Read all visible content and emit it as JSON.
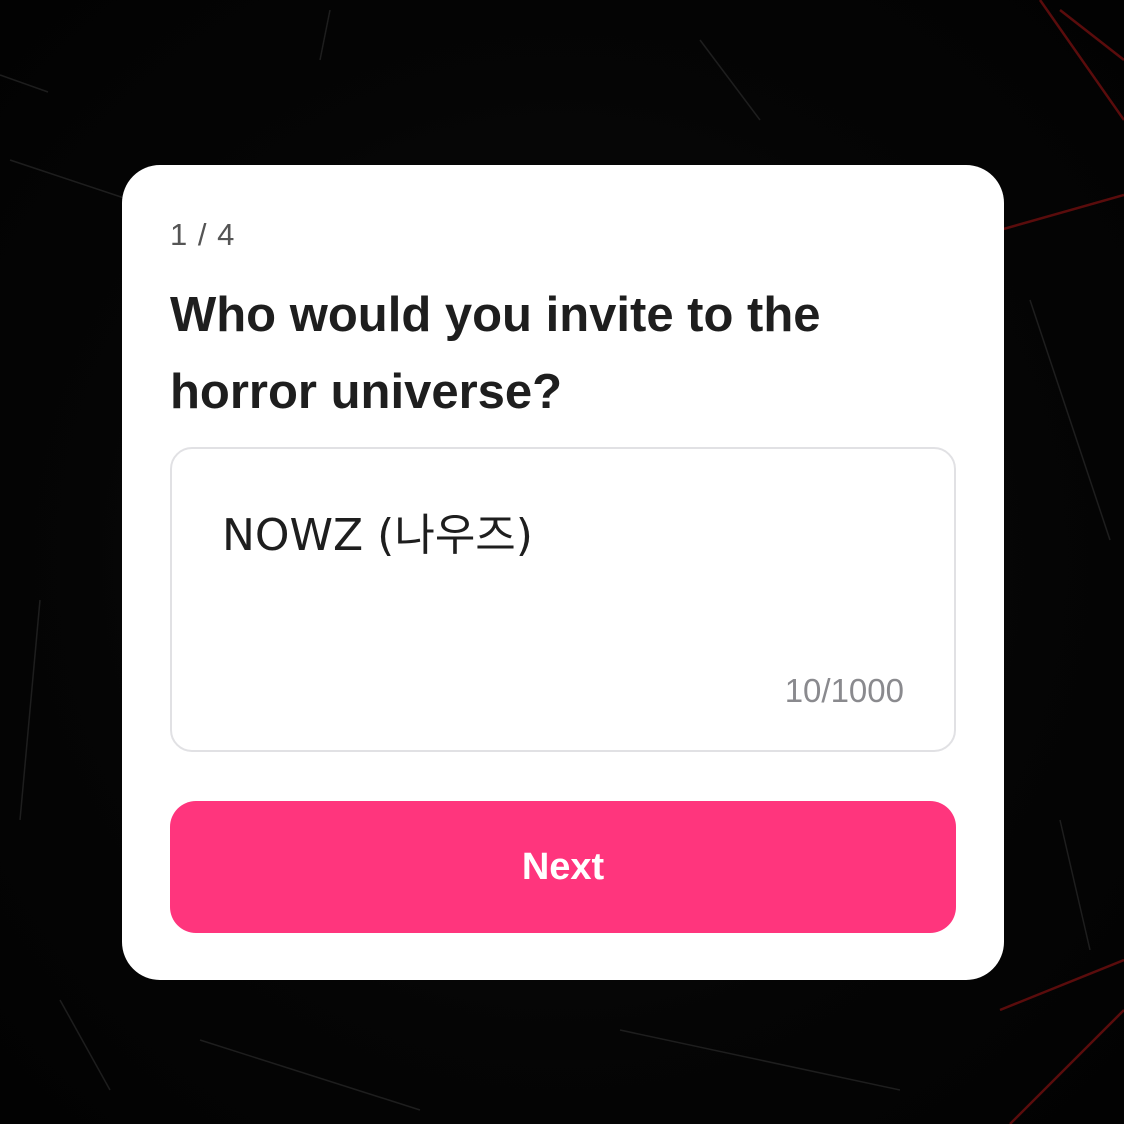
{
  "survey": {
    "step_indicator": "1 / 4",
    "question": "Who would you invite to the horror universe?",
    "answer": {
      "value": "NOWZ (나우즈)",
      "char_count": "10/1000"
    },
    "next_label": "Next"
  },
  "colors": {
    "accent": "#ff357d",
    "background": "#050505",
    "card": "#ffffff",
    "scratch": "#8a1010"
  }
}
